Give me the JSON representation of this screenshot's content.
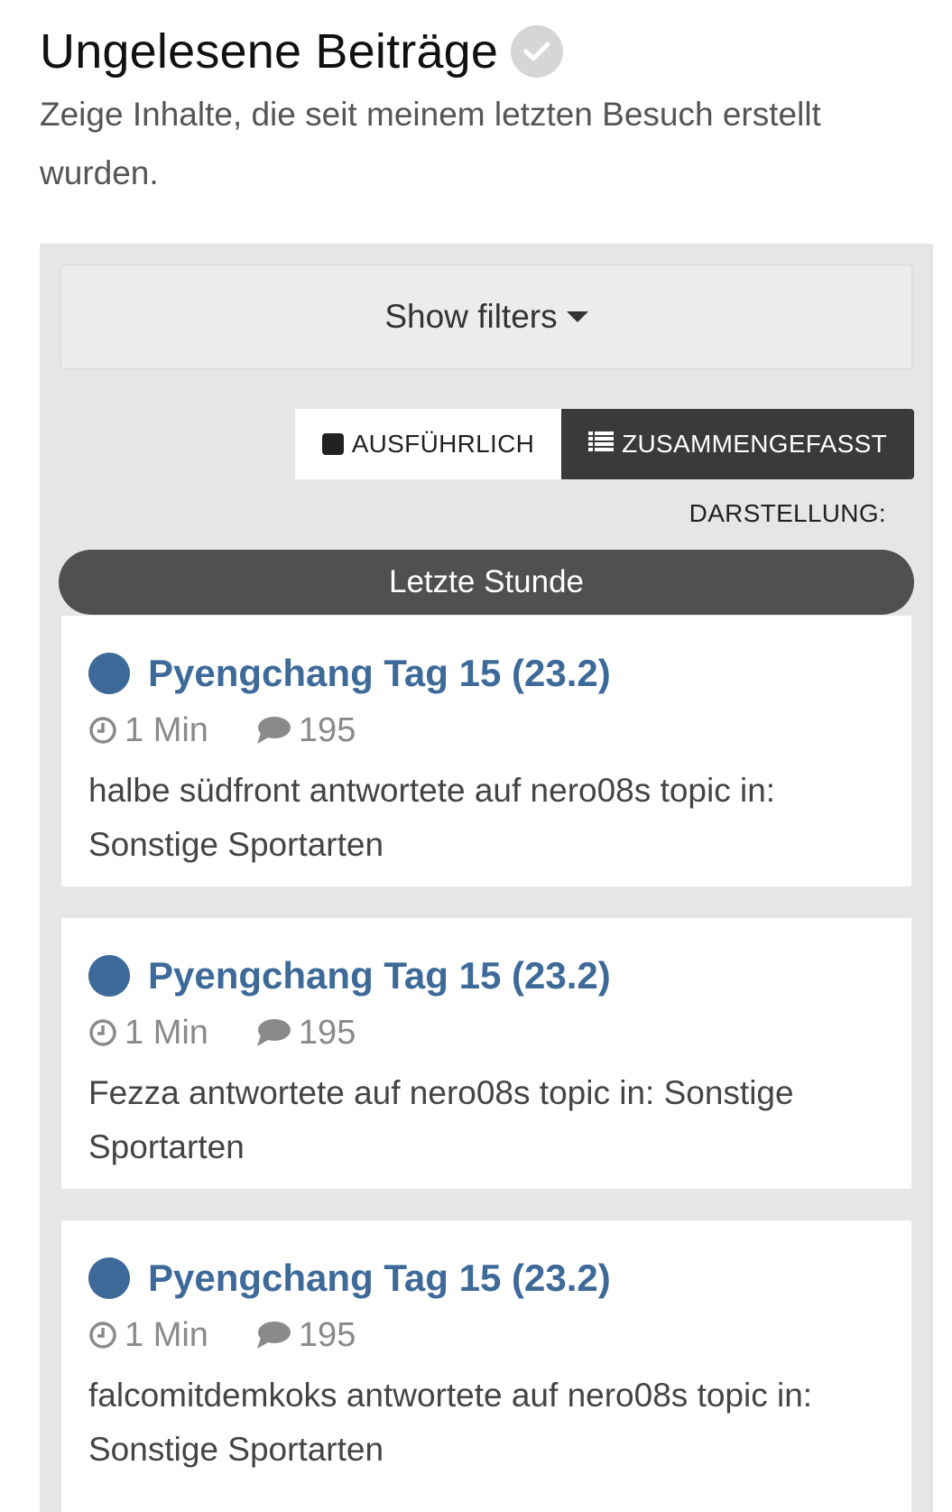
{
  "page": {
    "title": "Ungelesene Beiträge",
    "subtitle": "Zeige Inhalte, die seit meinem letzten Besuch erstellt wurden."
  },
  "filters": {
    "label": "Show filters"
  },
  "view_toggle": {
    "expanded_label": "AUSFÜHRLICH",
    "condensed_label": "ZUSAMMENGEFASST",
    "active": "condensed"
  },
  "view_mode_label": "DARSTELLUNG:",
  "period": {
    "label": "Letzte Stunde"
  },
  "items": [
    {
      "title": "Pyengchang Tag 15 (23.2)",
      "time": "1 Min",
      "comments": "195",
      "description": "halbe südfront antwortete auf nero08s topic in: Sonstige Sportarten"
    },
    {
      "title": "Pyengchang Tag 15 (23.2)",
      "time": "1 Min",
      "comments": "195",
      "description": "Fezza antwortete auf nero08s topic in: Sonstige Sportarten"
    },
    {
      "title": "Pyengchang Tag 15 (23.2)",
      "time": "1 Min",
      "comments": "195",
      "description": "falcomitdemkoks antwortete auf nero08s topic in: Sonstige Sportarten"
    }
  ],
  "colors": {
    "accent": "#3d6a99",
    "panel_bg": "#e6e6e6",
    "active_toggle": "#3a3a3a",
    "period_bar": "#505050"
  },
  "icons": {
    "title_badge": "check-circle-icon",
    "filter_caret": "caret-down-icon",
    "expanded": "square-icon",
    "condensed": "list-icon",
    "unread": "unread-dot-icon",
    "time": "clock-icon",
    "comments": "comment-icon"
  }
}
